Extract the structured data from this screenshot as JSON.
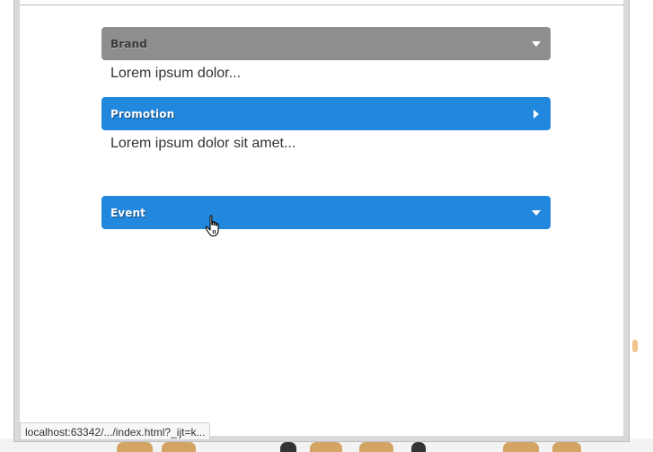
{
  "accordion": {
    "panels": [
      {
        "title": "Brand",
        "state": "expanded",
        "color": "#8e8e8e",
        "arrow_icon": "caret-down-icon",
        "content": "Lorem ipsum dolor..."
      },
      {
        "title": "Promotion",
        "state": "collapsed",
        "color": "#2288dd",
        "arrow_icon": "caret-right-icon",
        "content": "Lorem ipsum dolor sit amet..."
      },
      {
        "title": "Event",
        "state": "expanded",
        "color": "#2288dd",
        "arrow_icon": "caret-down-icon",
        "content": ""
      }
    ]
  },
  "status_bar": {
    "url": "localhost:63342/.../index.html?_ijt=k..."
  },
  "cursor": {
    "icon": "hand-pointer-icon"
  }
}
